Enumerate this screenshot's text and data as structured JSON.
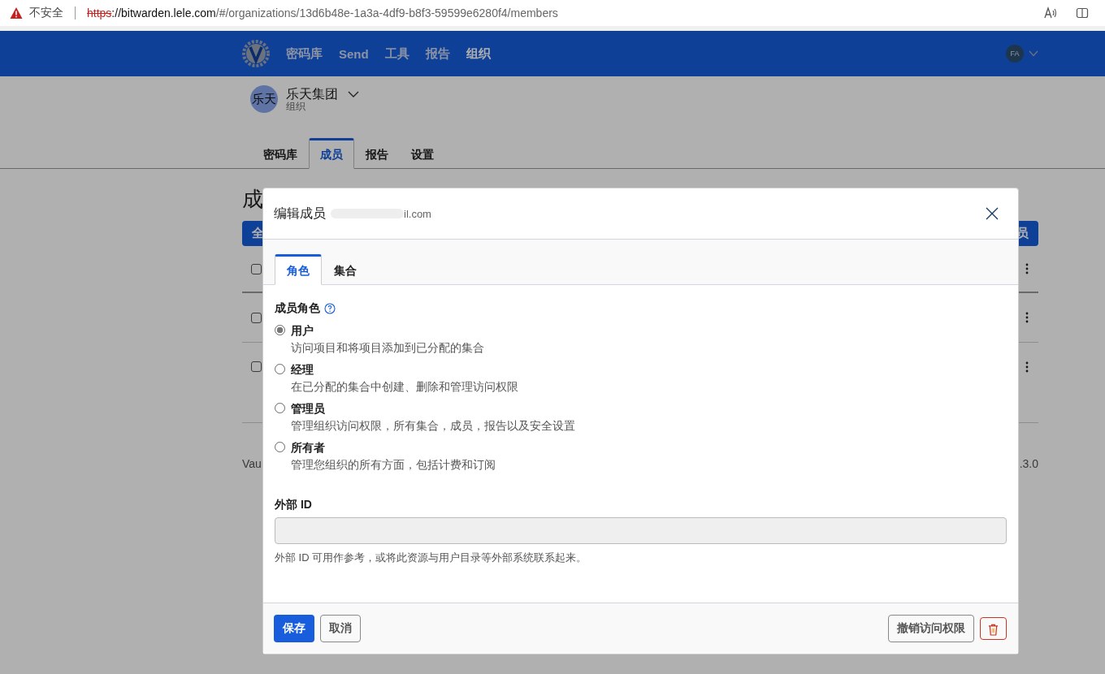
{
  "browser": {
    "security_label": "不安全",
    "url_scheme": "https",
    "url_host": "://bitwarden.lele.com",
    "url_path": "/#/organizations/13d6b48e-1a3a-4df9-b8f3-59599e6280f4/members"
  },
  "navbar": {
    "items": [
      {
        "label": "密码库",
        "selected": false
      },
      {
        "label": "Send",
        "selected": false
      },
      {
        "label": "工具",
        "selected": false
      },
      {
        "label": "报告",
        "selected": false
      },
      {
        "label": "组织",
        "selected": true
      }
    ],
    "avatar": "FA"
  },
  "org": {
    "avatar_text": "乐天",
    "name": "乐天集团",
    "subtitle": "组织"
  },
  "org_tabs": [
    {
      "label": "密码库",
      "selected": false
    },
    {
      "label": "成员",
      "selected": true
    },
    {
      "label": "报告",
      "selected": false
    },
    {
      "label": "设置",
      "selected": false
    }
  ],
  "page": {
    "heading": "成",
    "left_button": "全",
    "right_button": "员",
    "rows": [
      {
        "checked": false
      },
      {
        "checked": false
      },
      {
        "checked": false
      }
    ],
    "footer_left": "Vau",
    "footer_right": ".3.0"
  },
  "dialog": {
    "title": "编辑成员",
    "email": "il.com",
    "tabs": [
      {
        "label": "角色",
        "selected": true
      },
      {
        "label": "集合",
        "selected": false
      }
    ],
    "role_label": "成员角色",
    "roles": [
      {
        "name": "用户",
        "description": "访问项目和将项目添加到已分配的集合",
        "selected": true
      },
      {
        "name": "经理",
        "description": "在已分配的集合中创建、删除和管理访问权限",
        "selected": false
      },
      {
        "name": "管理员",
        "description": "管理组织访问权限，所有集合，成员，报告以及安全设置",
        "selected": false
      },
      {
        "name": "所有者",
        "description": "管理您组织的所有方面，包括计费和订阅",
        "selected": false
      }
    ],
    "external_id_label": "外部 ID",
    "external_id_help": "外部 ID 可用作参考，或将此资源与用户目录等外部系统联系起来。",
    "save_button": "保存",
    "cancel_button": "取消",
    "revoke_button": "撤销访问权限"
  }
}
